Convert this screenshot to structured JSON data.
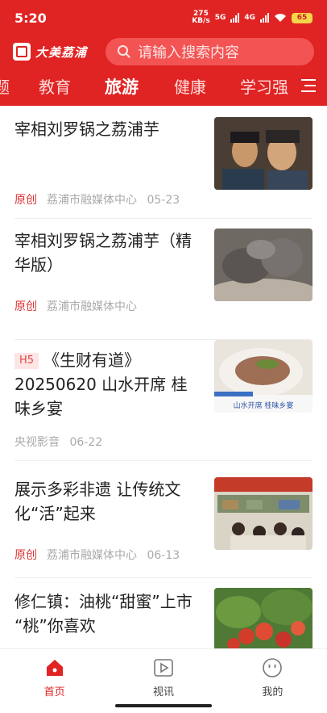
{
  "status": {
    "time": "5:20",
    "speed_top": "275",
    "speed_bottom": "KB/s",
    "net1": "5G",
    "net2": "4G",
    "battery": "65"
  },
  "header": {
    "logo_text": "大美荔浦",
    "search_placeholder": "请输入搜索内容"
  },
  "tabs": [
    {
      "label": "题",
      "active": false
    },
    {
      "label": "教育",
      "active": false
    },
    {
      "label": "旅游",
      "active": true
    },
    {
      "label": "健康",
      "active": false
    },
    {
      "label": "学习强",
      "active": false
    }
  ],
  "articles": [
    {
      "title": "宰相刘罗锅之荔浦芋",
      "badge": "",
      "tag": "原创",
      "source": "荔浦市融媒体中心",
      "date": "05-23"
    },
    {
      "title": "宰相刘罗锅之荔浦芋（精华版）",
      "badge": "",
      "tag": "原创",
      "source": "荔浦市融媒体中心",
      "date": ""
    },
    {
      "title": "《生财有道》20250620 山水开席 桂味乡宴",
      "badge": "H5",
      "tag": "",
      "source": "央视影音",
      "date": "06-22",
      "thumb_caption": "山水开席  桂味乡宴"
    },
    {
      "title": "展示多彩非遗 让传统文化“活”起来",
      "badge": "",
      "tag": "原创",
      "source": "荔浦市融媒体中心",
      "date": "06-13"
    },
    {
      "title": "修仁镇：油桃“甜蜜”上市 “桃”你喜欢",
      "badge": "",
      "tag": "",
      "source": "",
      "date": ""
    }
  ],
  "tabbar": [
    {
      "label": "首页",
      "icon": "home-icon",
      "active": true
    },
    {
      "label": "视讯",
      "icon": "video-icon",
      "active": false
    },
    {
      "label": "我的",
      "icon": "smile-icon",
      "active": false
    }
  ],
  "colors": {
    "brand": "#e02423",
    "tag": "#d33333",
    "meta": "#aaaaaa"
  }
}
